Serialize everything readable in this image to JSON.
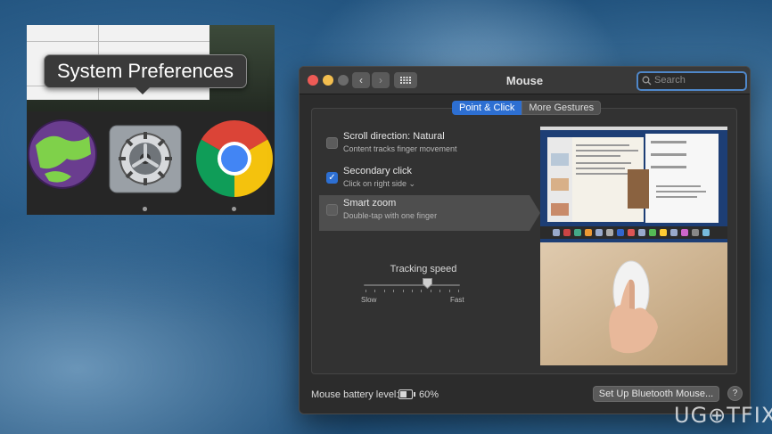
{
  "dock": {
    "tooltip": "System Preferences",
    "icons": [
      "globe-app-icon",
      "system-preferences-icon",
      "chrome-icon"
    ]
  },
  "window": {
    "title": "Mouse",
    "search_placeholder": "Search",
    "tabs": [
      {
        "label": "Point & Click",
        "active": true
      },
      {
        "label": "More Gestures",
        "active": false
      }
    ],
    "options": [
      {
        "title": "Scroll direction: Natural",
        "subtitle": "Content tracks finger movement",
        "checked": false
      },
      {
        "title": "Secondary click",
        "subtitle": "Click on right side",
        "checked": true
      },
      {
        "title": "Smart zoom",
        "subtitle": "Double-tap with one finger",
        "checked": false
      }
    ],
    "tracking": {
      "label": "Tracking speed",
      "slow": "Slow",
      "fast": "Fast",
      "level": 0.66
    },
    "battery": {
      "label": "Mouse battery level:",
      "value": "60%",
      "level": 0.6
    },
    "bluetooth_button": "Set Up Bluetooth Mouse...",
    "help_button": "?"
  },
  "watermark": "UG⊕TFIX",
  "colors": {
    "accent": "#2d6fd2",
    "window_bg": "#2c2c2c",
    "close": "#ee5b56",
    "minimize": "#f3be4f",
    "zoom": "#6b6b6b"
  }
}
